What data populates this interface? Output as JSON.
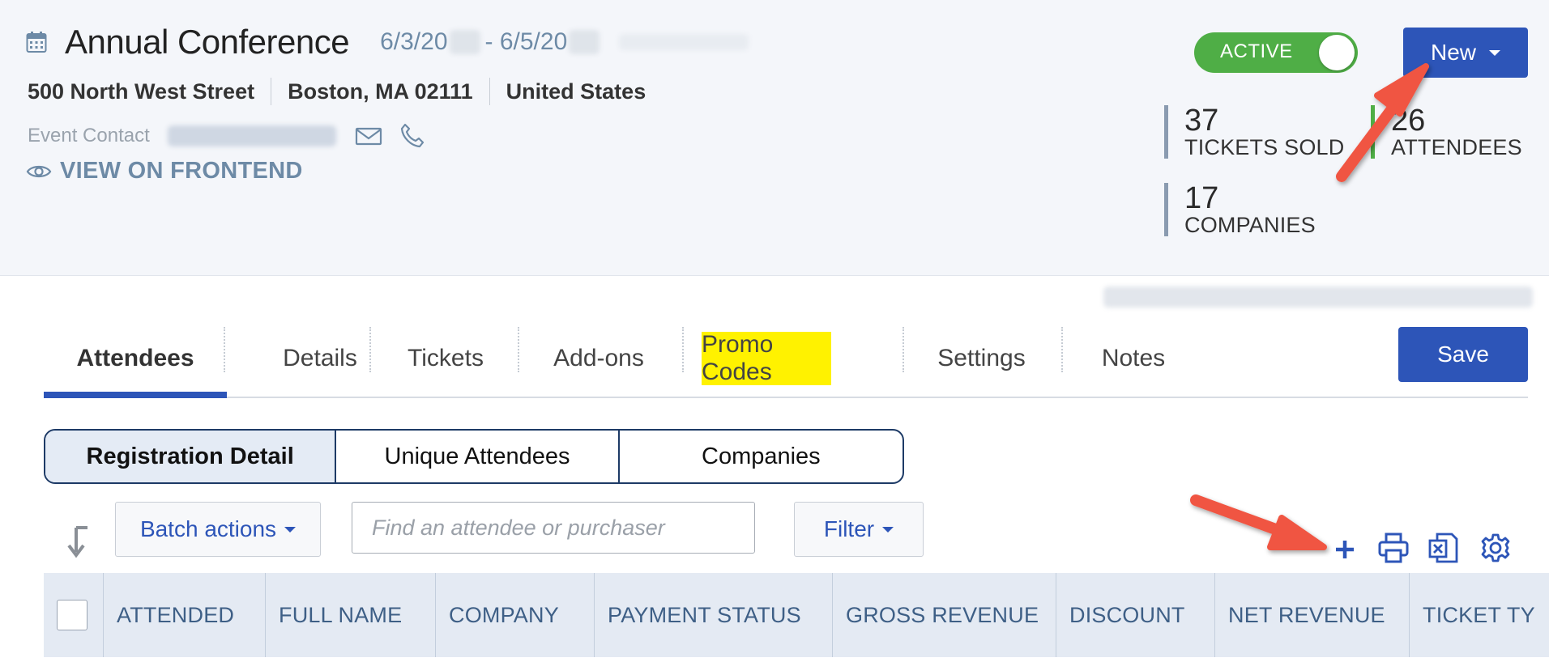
{
  "event": {
    "title": "Annual Conference",
    "date_start": "6/3/20",
    "date_sep": "- 6/5/20",
    "address_street": "500 North West Street",
    "address_city": "Boston, MA 02111",
    "address_country": "United States",
    "contact_label": "Event Contact",
    "view_frontend": "VIEW ON FRONTEND"
  },
  "status_toggle": {
    "label": "ACTIVE",
    "on": true
  },
  "new_button": {
    "label": "New"
  },
  "stats": [
    {
      "value": "37",
      "label": "TICKETS SOLD"
    },
    {
      "value": "26",
      "label": "ATTENDEES"
    },
    {
      "value": "17",
      "label": "COMPANIES"
    }
  ],
  "tabs": [
    {
      "label": "Attendees",
      "active": true
    },
    {
      "label": "Details"
    },
    {
      "label": "Tickets"
    },
    {
      "label": "Add-ons"
    },
    {
      "label": "Promo Codes",
      "highlighted": true
    },
    {
      "label": "Settings"
    },
    {
      "label": "Notes"
    }
  ],
  "save_button": {
    "label": "Save"
  },
  "view_switch": [
    {
      "label": "Registration Detail",
      "active": true
    },
    {
      "label": "Unique Attendees"
    },
    {
      "label": "Companies"
    }
  ],
  "toolbar": {
    "batch_label": "Batch actions",
    "search_placeholder": "Find an attendee or purchaser",
    "filter_label": "Filter",
    "icons": [
      "plus-icon",
      "print-icon",
      "excel-export-icon",
      "gear-icon"
    ]
  },
  "table": {
    "columns": [
      "ATTENDED",
      "FULL NAME",
      "COMPANY",
      "PAYMENT STATUS",
      "GROSS REVENUE",
      "DISCOUNT",
      "NET REVENUE",
      "TICKET TY"
    ]
  },
  "colors": {
    "primary": "#2d55b8",
    "toggle_on": "#4fae46",
    "muted_blue": "#6d8aa6",
    "highlight": "#fff200",
    "annotation_arrow": "#f05542"
  }
}
